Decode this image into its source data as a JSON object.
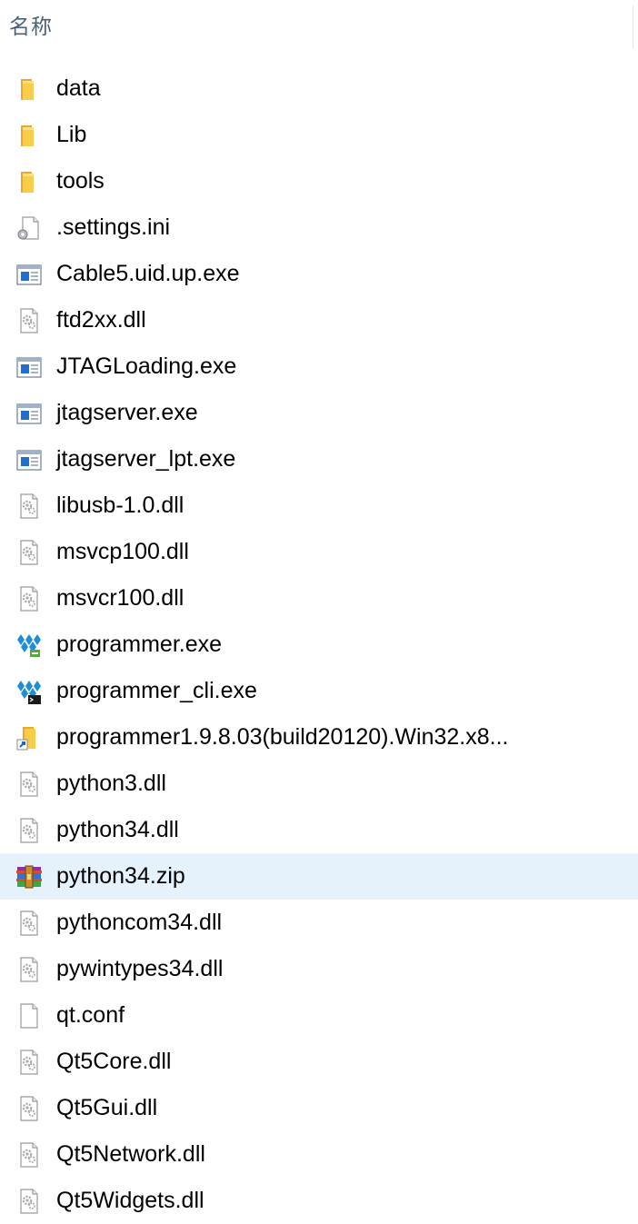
{
  "header": {
    "name_column": "名称"
  },
  "files": [
    {
      "name": "data",
      "icon": "folder-icon"
    },
    {
      "name": "Lib",
      "icon": "folder-icon"
    },
    {
      "name": "tools",
      "icon": "folder-icon"
    },
    {
      "name": ".settings.ini",
      "icon": "settings-file-icon"
    },
    {
      "name": "Cable5.uid.up.exe",
      "icon": "exe-icon"
    },
    {
      "name": "ftd2xx.dll",
      "icon": "dll-icon"
    },
    {
      "name": "JTAGLoading.exe",
      "icon": "exe-icon"
    },
    {
      "name": "jtagserver.exe",
      "icon": "exe-icon"
    },
    {
      "name": "jtagserver_lpt.exe",
      "icon": "exe-icon"
    },
    {
      "name": "libusb-1.0.dll",
      "icon": "dll-icon"
    },
    {
      "name": "msvcp100.dll",
      "icon": "dll-icon"
    },
    {
      "name": "msvcr100.dll",
      "icon": "dll-icon"
    },
    {
      "name": "programmer.exe",
      "icon": "programmer-app-icon"
    },
    {
      "name": "programmer_cli.exe",
      "icon": "programmer-cli-icon"
    },
    {
      "name": "programmer1.9.8.03(build20120).Win32.x8...",
      "icon": "folder-shortcut-icon"
    },
    {
      "name": "python3.dll",
      "icon": "dll-icon"
    },
    {
      "name": "python34.dll",
      "icon": "dll-icon"
    },
    {
      "name": "python34.zip",
      "icon": "zip-archive-icon",
      "selected": true
    },
    {
      "name": "pythoncom34.dll",
      "icon": "dll-icon"
    },
    {
      "name": "pywintypes34.dll",
      "icon": "dll-icon"
    },
    {
      "name": "qt.conf",
      "icon": "blank-file-icon"
    },
    {
      "name": "Qt5Core.dll",
      "icon": "dll-icon"
    },
    {
      "name": "Qt5Gui.dll",
      "icon": "dll-icon"
    },
    {
      "name": "Qt5Network.dll",
      "icon": "dll-icon"
    },
    {
      "name": "Qt5Widgets.dll",
      "icon": "dll-icon"
    }
  ],
  "colors": {
    "header_text": "#4c607a",
    "selection_background": "#e5f1fb",
    "folder_yellow": "#f5c542",
    "exe_blue": "#1f6fd1"
  }
}
